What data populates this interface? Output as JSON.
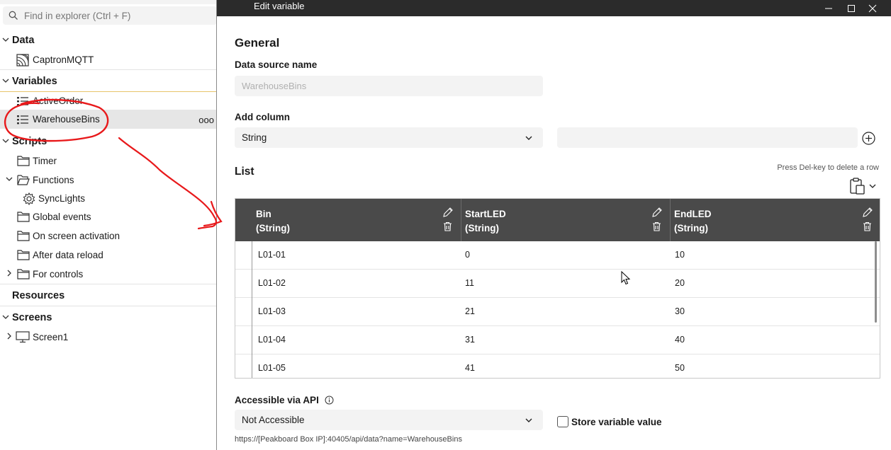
{
  "explorer": {
    "search_placeholder": "Find in explorer (Ctrl + F)",
    "data_label": "Data",
    "data_items": [
      "CaptronMQTT"
    ],
    "variables_label": "Variables",
    "variable_items": [
      "ActiveOrder",
      "WarehouseBins"
    ],
    "more_label": "ooo",
    "scripts_label": "Scripts",
    "script_items": {
      "timer": "Timer",
      "functions": "Functions",
      "synclights": "SyncLights",
      "global_events": "Global events",
      "on_screen_activation": "On screen activation",
      "after_data_reload": "After data reload",
      "for_controls": "For controls"
    },
    "resources_label": "Resources",
    "screens_label": "Screens",
    "screen_items": [
      "Screen1"
    ]
  },
  "dialog": {
    "title": "Edit variable",
    "general_heading": "General",
    "data_source_label": "Data source name",
    "data_source_value": "WarehouseBins",
    "add_column_label": "Add column",
    "column_type": "String",
    "column_name_value": "",
    "list_heading": "List",
    "delete_hint": "Press Del-key to delete a row",
    "columns": [
      {
        "name": "Bin",
        "type": "(String)"
      },
      {
        "name": "StartLED",
        "type": "(String)"
      },
      {
        "name": "EndLED",
        "type": "(String)"
      }
    ],
    "rows": [
      [
        "L01-01",
        "0",
        "10"
      ],
      [
        "L01-02",
        "11",
        "20"
      ],
      [
        "L01-03",
        "21",
        "30"
      ],
      [
        "L01-04",
        "31",
        "40"
      ],
      [
        "L01-05",
        "41",
        "50"
      ]
    ],
    "api_label": "Accessible via API",
    "api_value": "Not Accessible",
    "store_label": "Store variable value",
    "store_checked": false,
    "api_url": "https://[Peakboard Box IP]:40405/api/data?name=WarehouseBins"
  },
  "colors": {
    "titlebar": "#2b2b2b",
    "grid_header": "#4a4a4a",
    "annotation": "#e8191b",
    "selection_border": "#e8c46a"
  }
}
